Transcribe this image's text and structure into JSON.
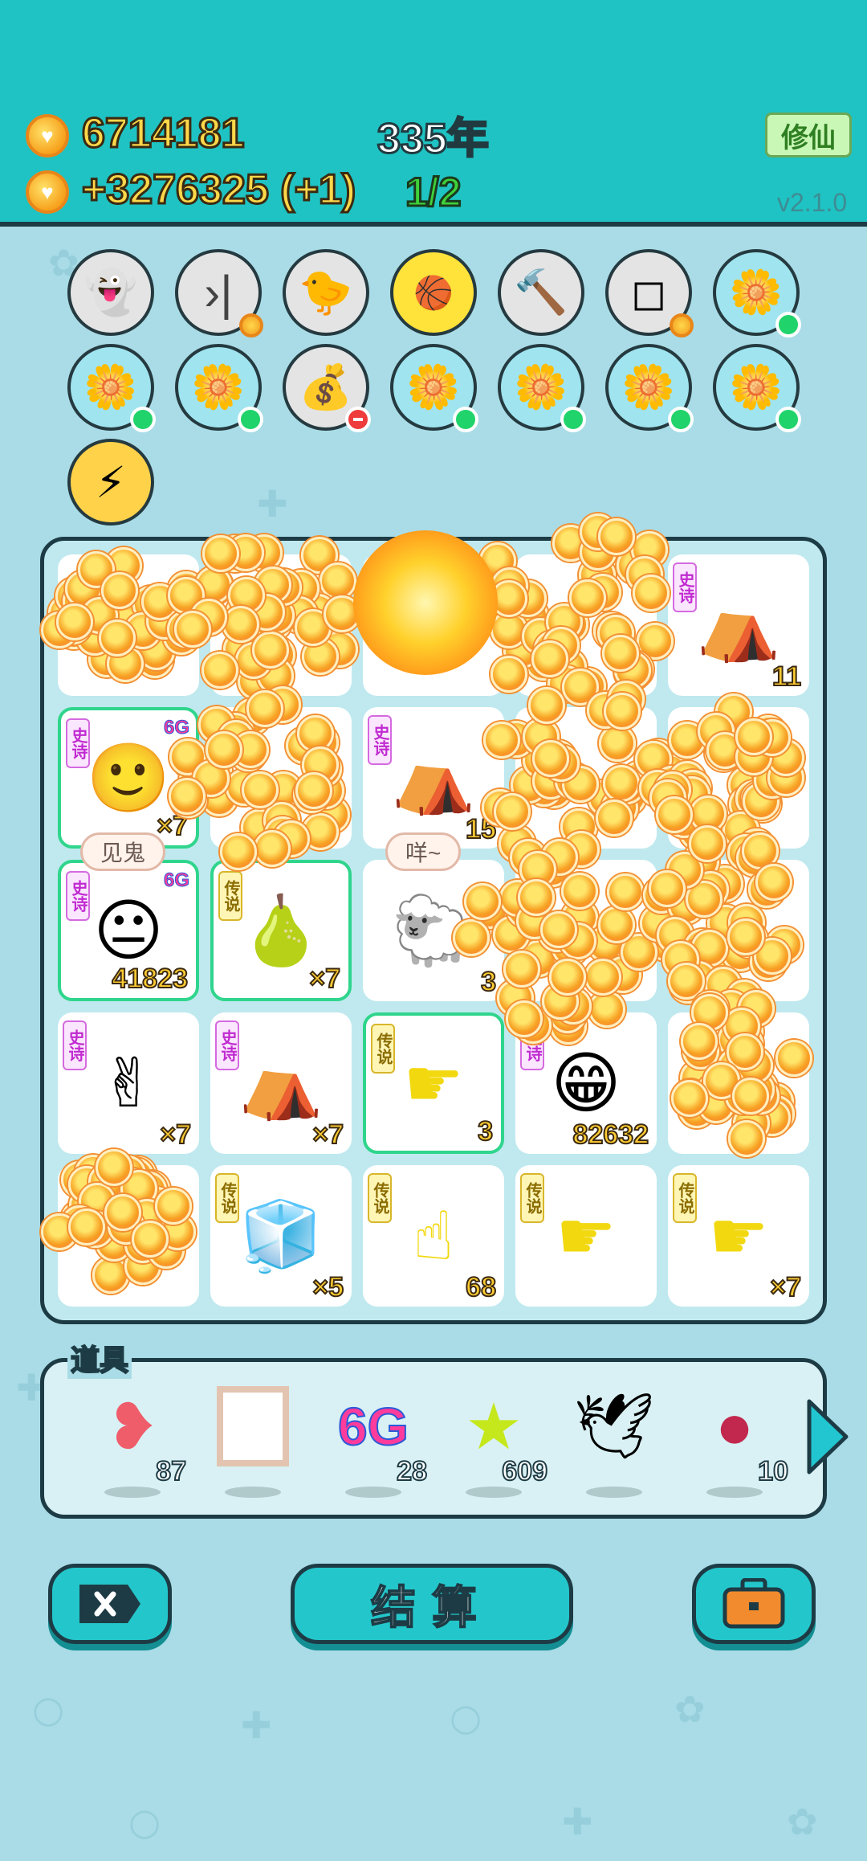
{
  "header": {
    "coins_total": "6714181",
    "coins_rate": "+3276325 (+1)",
    "years": "335年",
    "progress": "1/2",
    "cultivate_button": "修仙",
    "version": "v2.1.0"
  },
  "relics": {
    "row1": [
      "ghost-icon",
      "skip-icon",
      "chick-icon",
      "basketballs-icon",
      "hammer-icon",
      "sugar-cubes-icon",
      "flower-pot-icon"
    ],
    "row2": [
      "flower-pot-icon",
      "flower-pot-icon",
      "money-bag-icon",
      "flower-pot-icon",
      "flower-pot-icon",
      "flower-pot-icon",
      "flower-pot-icon"
    ],
    "row3": [
      "lightning-icon"
    ]
  },
  "board": {
    "rarity_epic": "史诗",
    "rarity_legend": "传说",
    "badge_6g": "6G",
    "cells": [
      {
        "id": "r1c5",
        "tag": "史诗",
        "count": "11",
        "icon": "pet-house-icon"
      },
      {
        "id": "r2c1",
        "tag": "史诗",
        "count": "×7",
        "icon": "face-icon"
      },
      {
        "id": "r2c3",
        "tag": "史诗",
        "count": "15",
        "icon": "pet-house-icon"
      },
      {
        "id": "r3c1",
        "tag": "史诗",
        "count": "41823",
        "icon": "face-icon",
        "bubble": "见鬼"
      },
      {
        "id": "r3c2",
        "tag": "传说",
        "count": "×7",
        "icon": "gourds-icon"
      },
      {
        "id": "r3c3",
        "tag": "",
        "count": "3",
        "icon": "sheep-icon",
        "bubble": "咩~"
      },
      {
        "id": "r4c1",
        "tag": "史诗",
        "count": "×7",
        "icon": "pointing-hand-icon"
      },
      {
        "id": "r4c2",
        "tag": "史诗",
        "count": "×7",
        "icon": "pet-house-icon"
      },
      {
        "id": "r4c3",
        "tag": "传说",
        "count": "3",
        "icon": "yellow-hand-icon"
      },
      {
        "id": "r4c4",
        "tag": "史诗",
        "count": "82632",
        "icon": "face-icon"
      },
      {
        "id": "r5c2",
        "tag": "传说",
        "count": "×5",
        "icon": "fridge-icon"
      },
      {
        "id": "r5c3",
        "tag": "传说",
        "count": "68",
        "icon": "yellow-hand-icon"
      },
      {
        "id": "r5c4",
        "tag": "传说",
        "count": "",
        "icon": "yellow-hand-icon"
      },
      {
        "id": "r5c5",
        "tag": "传说",
        "count": "×7",
        "icon": "yellow-hand-icon"
      }
    ]
  },
  "tools": {
    "title": "道具",
    "items": [
      {
        "icon": "liver-icon",
        "count": "87"
      },
      {
        "icon": "frame-icon",
        "count": ""
      },
      {
        "icon": "6g-icon",
        "label": "6G",
        "count": "28"
      },
      {
        "icon": "star-icon",
        "count": "609"
      },
      {
        "icon": "bird-icon",
        "count": ""
      },
      {
        "icon": "lychee-icon",
        "count": "10"
      }
    ]
  },
  "buttons": {
    "settle": "结算"
  }
}
